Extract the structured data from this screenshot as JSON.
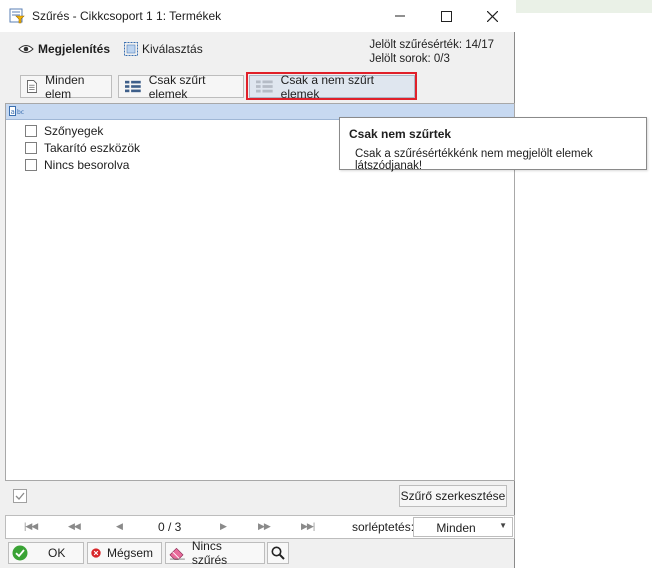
{
  "window": {
    "title": "Szűrés - Cikkcsoport 1 1: Termékek"
  },
  "modes": {
    "view_label": "Megjelenítés",
    "select_label": "Kiválasztás"
  },
  "stats": {
    "marked_values": "Jelölt szűrésérték: 14/17",
    "marked_rows": "Jelölt sorok: 0/3"
  },
  "filter_buttons": {
    "all": "Minden elem",
    "filtered": "Csak szűrt elemek",
    "not_filtered": "Csak a nem szűrt elemek"
  },
  "list": {
    "header_icon": "abc-text-icon",
    "items": [
      "Szőnyegek",
      "Takarító eszközök",
      "Nincs besorolva"
    ]
  },
  "tooltip": {
    "title": "Csak nem szűrtek",
    "text": "Csak a szűrésértékkénk nem megjelölt elemek látszódjanak!"
  },
  "bottom": {
    "edit_filter": "Szűrő szerkesztése",
    "page": "0 / 3",
    "sort_label": "sorléptetés:",
    "sort_value": "Minden"
  },
  "actions": {
    "ok": "OK",
    "cancel": "Mégsem",
    "no_filter": "Nincs szűrés"
  },
  "colors": {
    "highlight": "#e0202a",
    "list_header": "#c7d9f1"
  }
}
